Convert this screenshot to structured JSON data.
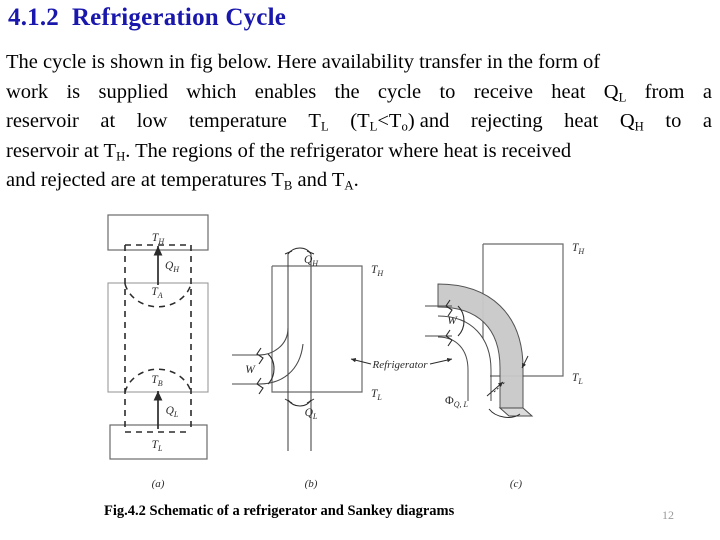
{
  "slide": {
    "title": "4.1.2  Refrigeration Cycle",
    "title_color": "#1a18ac",
    "page_number": "12"
  },
  "body": {
    "line1": "The cycle is shown in fig below. Here availability transfer in the form of",
    "line2_words": [
      "work",
      "is",
      "supplied",
      "which",
      "enables",
      "the",
      "cycle",
      "to",
      "receive",
      "heat",
      "Q",
      "from",
      "a"
    ],
    "line2_sub": "L",
    "line3_words": [
      "reservoir",
      "at",
      "low",
      "temperature",
      "T",
      "(T",
      "<T",
      ") and",
      "rejecting",
      "heat",
      "Q",
      "to",
      "a"
    ],
    "line3_subs": [
      "L",
      "L",
      "o",
      "H"
    ],
    "line4": "reservoir at T",
    "line4_sub": "H",
    "line4_rest": ".  The regions of the refrigerator where heat is received",
    "line5": "and rejected are at temperatures T",
    "line5_sub": "B",
    "line5_mid": " and T",
    "line5_sub2": "A",
    "line5_end": "."
  },
  "figure": {
    "caption": "Fig.4.2  Schematic of a refrigerator and Sankey diagrams",
    "panel_a": {
      "label": "(a)",
      "reservoir_hot": "T",
      "reservoir_hot_sub": "H",
      "reservoir_cold": "T",
      "reservoir_cold_sub": "L",
      "region_hot": "T",
      "region_hot_sub": "A",
      "region_cold": "T",
      "region_cold_sub": "B",
      "heat_out": "Q",
      "heat_out_sub": "H",
      "heat_in": "Q",
      "heat_in_sub": "L"
    },
    "panel_b": {
      "label": "(b)",
      "q_top": "Q",
      "q_top_sub": "H",
      "q_bottom": "Q",
      "q_bottom_sub": "L",
      "work": "W",
      "temp_high": "T",
      "temp_high_sub": "H",
      "temp_low": "T",
      "temp_low_sub": "L",
      "device": "Refrigerator"
    },
    "panel_c": {
      "label": "(c)",
      "work": "W",
      "exergy": "Φ",
      "exergy_sub": "Q, L",
      "temp_high": "T",
      "temp_high_sub": "H",
      "temp_low": "T",
      "temp_low_sub": "L"
    }
  },
  "colors": {
    "ink": "#1a1a1a",
    "line": "#3a3a3a",
    "band_fill": "#c9c9c9",
    "box_line": "#555555"
  }
}
